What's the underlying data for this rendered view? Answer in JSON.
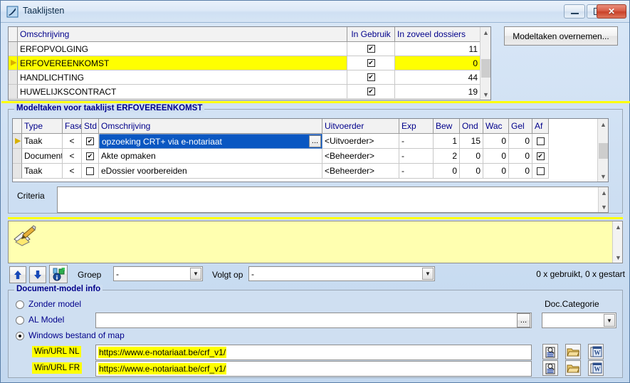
{
  "window": {
    "title": "Taaklijsten",
    "icon": "app-icon",
    "buttons": {
      "minimize": "minimize",
      "maximize": "maximize",
      "close": "close"
    }
  },
  "tasklists_grid": {
    "columns": [
      "Omschrijving",
      "In Gebruik",
      "In zoveel dossiers"
    ],
    "rows": [
      {
        "selected": false,
        "omschrijving": "ERFOPVOLGING",
        "in_gebruik": true,
        "dossiers": "11"
      },
      {
        "selected": true,
        "omschrijving": "ERFOVEREENKOMST",
        "in_gebruik": true,
        "dossiers": "0"
      },
      {
        "selected": false,
        "omschrijving": "HANDLICHTING",
        "in_gebruik": true,
        "dossiers": "44"
      },
      {
        "selected": false,
        "omschrijving": "HUWELIJKSCONTRACT",
        "in_gebruik": true,
        "dossiers": "19"
      }
    ]
  },
  "take_over_button": {
    "label": "Modeltaken overnemen..."
  },
  "modeltaken": {
    "legend": "Modeltaken voor taaklijst ERFOVEREENKOMST",
    "columns": [
      "Type",
      "Fase",
      "Std",
      "Omschrijving",
      "Uitvoerder",
      "Exp",
      "Bew",
      "Ond",
      "Wac",
      "Gel",
      "Af"
    ],
    "rows": [
      {
        "current": true,
        "selected": true,
        "type": "Taak",
        "fase": "<",
        "std": true,
        "omschrijving": "opzoeking CRT+ via e-notariaat",
        "uitvoerder": "<Uitvoerder>",
        "exp": "-",
        "bew": "1",
        "ond": "15",
        "wac": "0",
        "gel": "0",
        "af": false
      },
      {
        "current": false,
        "selected": false,
        "type": "Document",
        "fase": "<",
        "std": true,
        "omschrijving": "Akte opmaken",
        "uitvoerder": "<Beheerder>",
        "exp": "-",
        "bew": "2",
        "ond": "0",
        "wac": "0",
        "gel": "0",
        "af": true
      },
      {
        "current": false,
        "selected": false,
        "type": "Taak",
        "fase": "<",
        "std": false,
        "omschrijving": "eDossier voorbereiden",
        "uitvoerder": "<Beheerder>",
        "exp": "-",
        "bew": "0",
        "ond": "0",
        "wac": "0",
        "gel": "0",
        "af": false
      }
    ],
    "ellipsis_button": "..."
  },
  "criteria": {
    "label": "Criteria",
    "value": ""
  },
  "notes": {
    "icon": "note-pencil-icon",
    "value": ""
  },
  "toolbar": {
    "move_up": "move-up-arrow",
    "move_down": "move-down-arrow",
    "info": "task-info-icon",
    "groep_label": "Groep",
    "groep_value": "-",
    "volgt_op_label": "Volgt op",
    "volgt_op_value": "-",
    "usage_text": "0 x gebruikt, 0 x gestart"
  },
  "document_model": {
    "legend": "Document-model info",
    "options": [
      {
        "label": "Zonder model",
        "selected": false
      },
      {
        "label": "AL Model",
        "selected": false
      },
      {
        "label": "Windows bestand of map",
        "selected": true
      }
    ],
    "al_model_value": "",
    "al_model_browse": "...",
    "doc_categorie_label": "Doc.Categorie",
    "doc_categorie_value": "",
    "url_nl_label": "Win/URL NL",
    "url_nl_value": "https://www.e-notariaat.be/crf_v1/",
    "url_fr_label": "Win/URL FR",
    "url_fr_value": "https://www.e-notariaat.be/crf_v1/",
    "row_icons": [
      "preview-document-icon",
      "open-folder-icon",
      "word-document-icon"
    ]
  },
  "colors": {
    "highlight_yellow": "#ffff00",
    "selection_blue": "#0a57c2",
    "label_blue": "#00008b",
    "panel": "#cfdff1",
    "note_yellow": "#ffffb0"
  }
}
